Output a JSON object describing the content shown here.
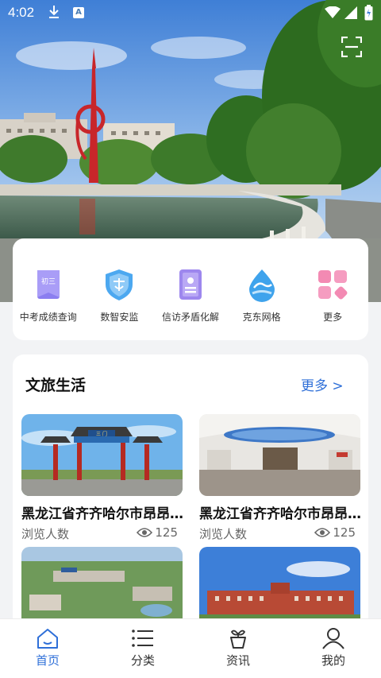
{
  "status_bar": {
    "time": "4:02",
    "badge": "A"
  },
  "quick_links": [
    {
      "label": "中考成绩查询",
      "icon": "exam-book-icon",
      "badge": "初三"
    },
    {
      "label": "数智安监",
      "icon": "shield-icon"
    },
    {
      "label": "信访矛盾化解",
      "icon": "petition-doc-icon"
    },
    {
      "label": "克东网格",
      "icon": "water-drop-icon"
    },
    {
      "label": "更多",
      "icon": "grid-apps-icon"
    }
  ],
  "culture": {
    "title": "文旅生活",
    "more_label": "更多 >",
    "items": [
      {
        "title": "黑龙江省齐齐哈尔市昂昂溪区",
        "views_label": "浏览人数",
        "views": "125"
      },
      {
        "title": "黑龙江省齐齐哈尔市昂昂溪区",
        "views_label": "浏览人数",
        "views": "125"
      }
    ]
  },
  "gate_plaque": "三 门",
  "nav": [
    {
      "label": "首页",
      "icon": "home-icon",
      "active": true
    },
    {
      "label": "分类",
      "icon": "list-icon",
      "active": false
    },
    {
      "label": "资讯",
      "icon": "plant-pot-icon",
      "active": false
    },
    {
      "label": "我的",
      "icon": "user-icon",
      "active": false
    }
  ]
}
